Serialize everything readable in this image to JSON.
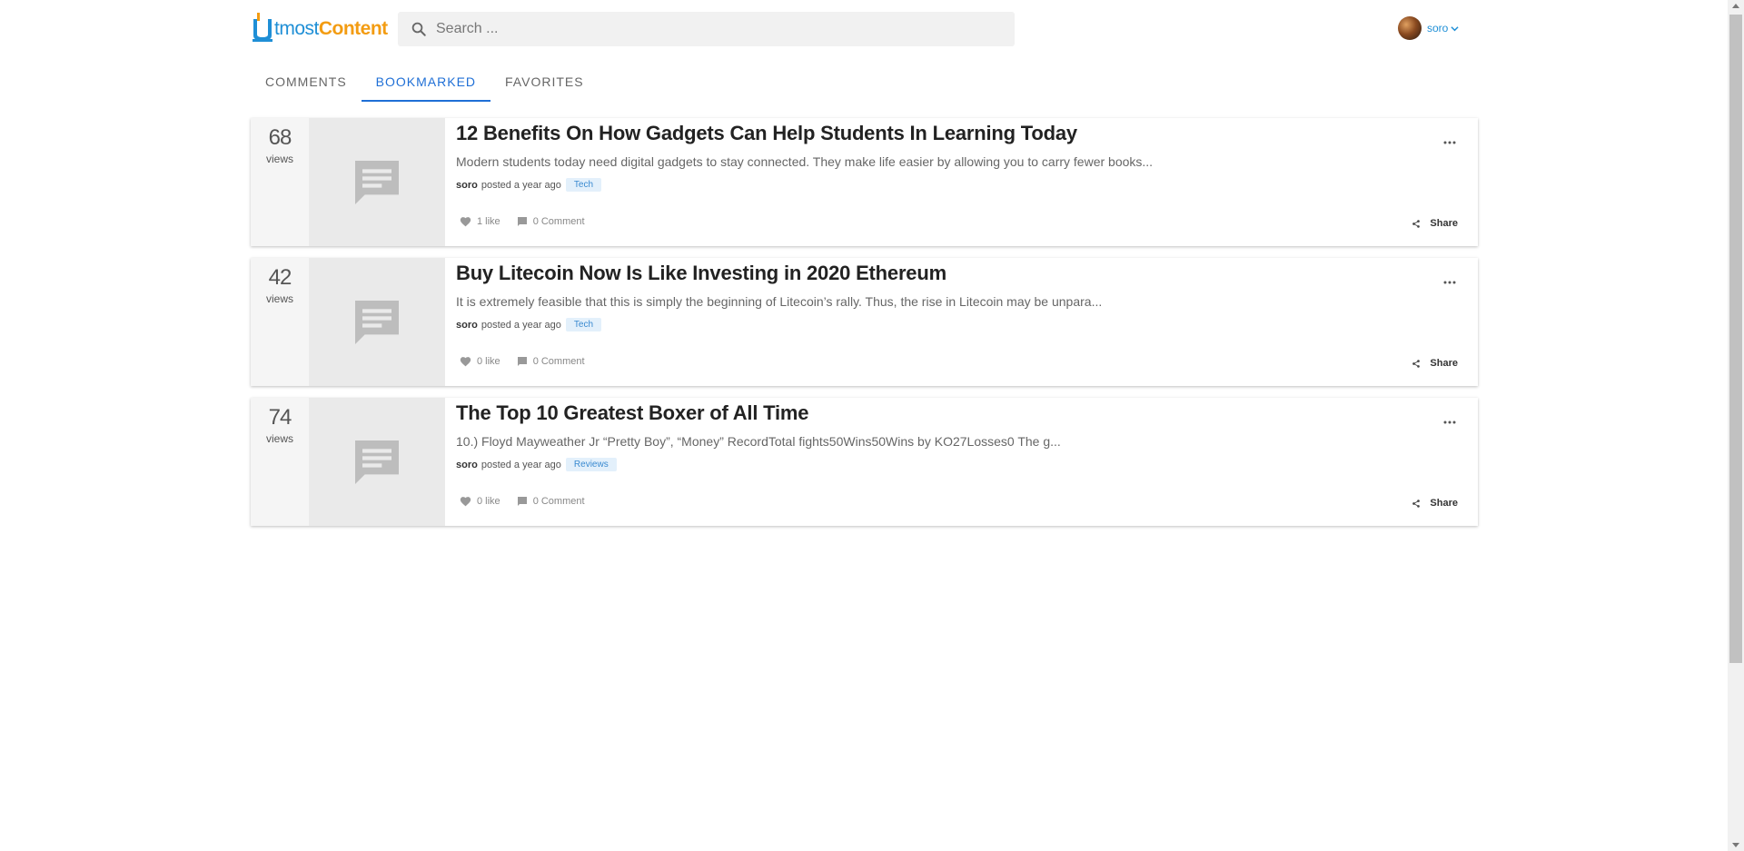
{
  "brand": {
    "part1": "U",
    "part2": "tmost",
    "part3": "Content"
  },
  "search": {
    "placeholder": "Search ..."
  },
  "user": {
    "name": "soro"
  },
  "tabs": [
    {
      "label": "COMMENTS",
      "active": false
    },
    {
      "label": "BOOKMARKED",
      "active": true
    },
    {
      "label": "FAVORITES",
      "active": false
    }
  ],
  "posts": [
    {
      "views": "68",
      "views_label": "views",
      "title": "12 Benefits On How Gadgets Can Help Students In Learning Today",
      "excerpt": "Modern students today need digital gadgets to stay connected. They make life easier by allowing you to carry fewer books...",
      "author": "soro",
      "posted": "posted a year ago",
      "tag": "Tech",
      "likes": "1 like",
      "comments": "0 Comment",
      "share": "Share"
    },
    {
      "views": "42",
      "views_label": "views",
      "title": "Buy Litecoin Now Is Like Investing in 2020 Ethereum",
      "excerpt": "It is extremely feasible that this is simply the beginning of Litecoin’s rally. Thus, the rise in Litecoin may be unpara...",
      "author": "soro",
      "posted": "posted a year ago",
      "tag": "Tech",
      "likes": "0 like",
      "comments": "0 Comment",
      "share": "Share"
    },
    {
      "views": "74",
      "views_label": "views",
      "title": "The Top 10 Greatest Boxer of All Time",
      "excerpt": "10.) Floyd Mayweather Jr “Pretty Boy”, “Money”   RecordTotal fights50Wins50Wins by KO27Losses0 The g...",
      "author": "soro",
      "posted": "posted a year ago",
      "tag": "Reviews",
      "likes": "0 like",
      "comments": "0 Comment",
      "share": "Share"
    }
  ],
  "colors": {
    "accent": "#1f6fd6",
    "brand_blue": "#1f8fd6",
    "brand_orange": "#f39c12",
    "tag_bg": "#e3f0fb"
  }
}
